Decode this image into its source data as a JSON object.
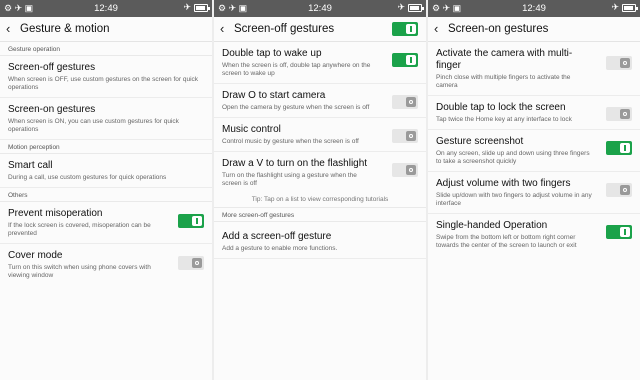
{
  "status_bar": {
    "time": "12:49"
  },
  "panel1": {
    "title": "Gesture & motion",
    "sections": [
      {
        "header": "Gesture operation",
        "items": [
          {
            "title": "Screen-off gestures",
            "desc": "When screen is OFF, use custom gestures on the screen for quick operations"
          },
          {
            "title": "Screen-on gestures",
            "desc": "When screen is ON, you can use custom gestures for quick operations"
          }
        ]
      },
      {
        "header": "Motion perception",
        "items": [
          {
            "title": "Smart call",
            "desc": "During a call, use custom gestures for quick operations"
          }
        ]
      },
      {
        "header": "Others",
        "items": [
          {
            "title": "Prevent misoperation",
            "desc": "If the lock screen is covered, misoperation can be prevented",
            "toggle": true
          },
          {
            "title": "Cover mode",
            "desc": "Turn on this switch when using phone covers with viewing window",
            "toggle": false
          }
        ]
      }
    ]
  },
  "panel2": {
    "title": "Screen-off gestures",
    "master_toggle": true,
    "items": [
      {
        "title": "Double tap to wake up",
        "desc": "When the screen is off, double tap anywhere on the screen to wake up",
        "toggle": true
      },
      {
        "title": "Draw O to start camera",
        "desc": "Open the camera by gesture when the screen is off",
        "toggle": false
      },
      {
        "title": "Music control",
        "desc": "Control music by gesture when the screen is off",
        "toggle": false
      },
      {
        "title": "Draw a V to turn on the flashlight",
        "desc": "Turn on the flashlight using a gesture when the screen is off",
        "toggle": false
      }
    ],
    "tip": "Tip: Tap on a list to view corresponding tutorials",
    "more_header": "More screen-off gestures",
    "add_item": {
      "title": "Add a screen-off gesture",
      "desc": "Add a gesture to enable more functions."
    }
  },
  "panel3": {
    "title": "Screen-on gestures",
    "items": [
      {
        "title": "Activate the camera with multi-finger",
        "desc": "Pinch close with multiple fingers to activate the camera",
        "toggle": false
      },
      {
        "title": "Double tap to lock the screen",
        "desc": "Tap twice the Home key at any interface to lock",
        "toggle": false
      },
      {
        "title": "Gesture screenshot",
        "desc": "On any screen, slide up and down using three fingers to take a screenshot quickly",
        "toggle": true
      },
      {
        "title": "Adjust volume with two fingers",
        "desc": "Slide up/down with two fingers to adjust volume in any interface",
        "toggle": false
      },
      {
        "title": "Single-handed Operation",
        "desc": "Swipe from the bottom left or bottom right corner towards the center of the screen to launch or exit",
        "toggle": true
      }
    ]
  },
  "colors": {
    "toggle_on": "#1ba24a",
    "toggle_off": "#e6e6e6",
    "status_bar": "#5b5b5b"
  }
}
